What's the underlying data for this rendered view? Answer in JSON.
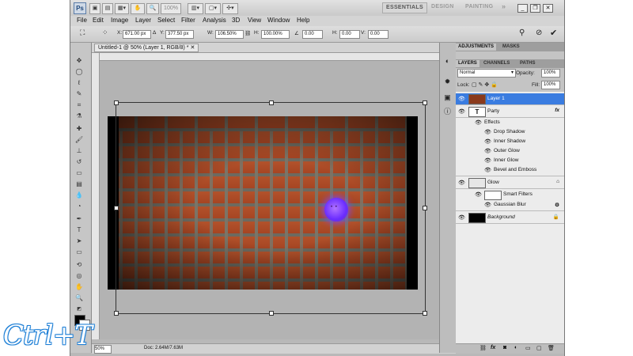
{
  "app": {
    "badge": "Ps",
    "zoom": "100%"
  },
  "workspaces": {
    "essentials": "ESSENTIALS",
    "design": "DESIGN",
    "painting": "PAINTING",
    "more": "»"
  },
  "menu": [
    "File",
    "Edit",
    "Image",
    "Layer",
    "Select",
    "Filter",
    "Analysis",
    "3D",
    "View",
    "Window",
    "Help"
  ],
  "options": {
    "x_label": "X:",
    "x": "671.00 px",
    "y_label": "Y:",
    "y": "377.50 px",
    "w_label": "W:",
    "w": "106.50%",
    "h_label": "H:",
    "h": "100.00%",
    "angle": "0.00",
    "hskew_label": "H:",
    "hskew": "0.00",
    "vskew_label": "V:",
    "vskew": "0.00"
  },
  "document": {
    "tab": "Untitled-1 @ 50% (Layer 1, RGB/8) *",
    "status_zoom": "50%",
    "doc_size": "Doc: 2.64M/7.63M"
  },
  "panels": {
    "top_tabs": [
      "ADJUSTMENTS",
      "MASKS"
    ],
    "tabs": [
      "LAYERS",
      "CHANNELS",
      "PATHS"
    ],
    "blend_mode": "Normal",
    "opacity_label": "Opacity:",
    "opacity": "100%",
    "lock_label": "Lock:",
    "fill_label": "Fill:",
    "fill": "100%"
  },
  "layers": [
    {
      "name": "Layer 1",
      "selected": true
    },
    {
      "name": "Party",
      "type_icon": "T",
      "fx": "fx"
    },
    {
      "name": "Effects"
    },
    {
      "name": "Drop Shadow"
    },
    {
      "name": "Inner Shadow"
    },
    {
      "name": "Outer Glow"
    },
    {
      "name": "Inner Glow"
    },
    {
      "name": "Bevel and Emboss"
    },
    {
      "name": "Glow"
    },
    {
      "name": "Smart Filters"
    },
    {
      "name": "Gaussian Blur"
    },
    {
      "name": "Background"
    }
  ],
  "overlay": {
    "shortcut": "Ctrl+T"
  }
}
